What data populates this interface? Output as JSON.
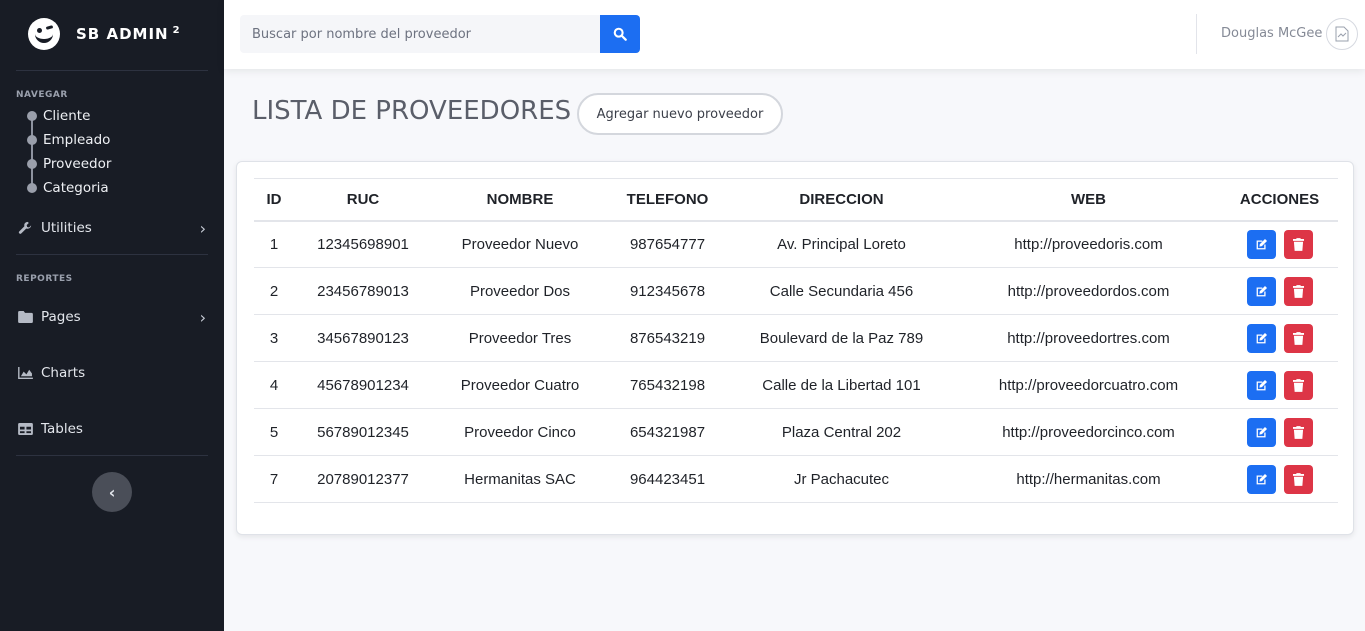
{
  "brand": {
    "name": "SB ADMIN",
    "sup": "2"
  },
  "sidebar": {
    "heading_nav": "NAVEGAR",
    "tree": [
      "Cliente",
      "Empleado",
      "Proveedor",
      "Categoria"
    ],
    "utilities": "Utilities",
    "heading_reports": "REPORTES",
    "pages": "Pages",
    "charts": "Charts",
    "tables": "Tables",
    "toggle_icon": "chevron-left-icon"
  },
  "topbar": {
    "search_placeholder": "Buscar por nombre del proveedor",
    "search_icon": "search-icon",
    "user_name": "Douglas McGee"
  },
  "page": {
    "title": "LISTA DE PROVEEDORES",
    "add_button": "Agregar nuevo proveedor"
  },
  "table": {
    "headers": [
      "ID",
      "RUC",
      "NOMBRE",
      "TELEFONO",
      "DIRECCION",
      "WEB",
      "ACCIONES"
    ],
    "rows": [
      [
        "1",
        "12345698901",
        "Proveedor Nuevo",
        "987654777",
        "Av. Principal Loreto",
        "http://proveedoris.com"
      ],
      [
        "2",
        "23456789013",
        "Proveedor Dos",
        "912345678",
        "Calle Secundaria 456",
        "http://proveedordos.com"
      ],
      [
        "3",
        "34567890123",
        "Proveedor Tres",
        "876543219",
        "Boulevard de la Paz 789",
        "http://proveedortres.com"
      ],
      [
        "4",
        "45678901234",
        "Proveedor Cuatro",
        "765432198",
        "Calle de la Libertad 101",
        "http://proveedorcuatro.com"
      ],
      [
        "5",
        "56789012345",
        "Proveedor Cinco",
        "654321987",
        "Plaza Central 202",
        "http://proveedorcinco.com"
      ],
      [
        "7",
        "20789012377",
        "Hermanitas SAC",
        "964423451",
        "Jr Pachacutec",
        "http://hermanitas.com"
      ]
    ]
  },
  "colors": {
    "primary": "#1c6ef2",
    "danger": "#dd3546",
    "sidebar": "#181c25"
  }
}
